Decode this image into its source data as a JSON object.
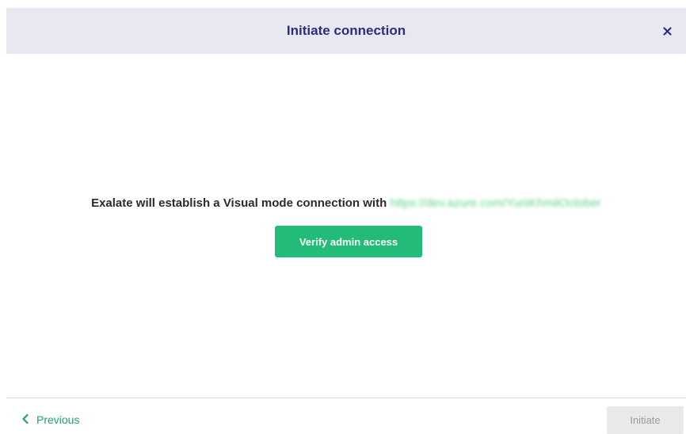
{
  "header": {
    "title": "Initiate connection",
    "close_icon": "close-icon"
  },
  "message": {
    "text": "Exalate will establish a Visual mode connection with ",
    "url": "https://dev.azure.com/YuriiKhmilOctober"
  },
  "verify": {
    "label": "Verify admin access"
  },
  "footer": {
    "previous_label": "Previous",
    "previous_icon": "chevron-left-icon",
    "initiate_label": "Initiate"
  },
  "colors": {
    "header_bg": "#e8e8f3",
    "title": "#2f2c7c",
    "accent": "#22bb78",
    "link": "#5fd38a",
    "disabled_bg": "#e9e9e9",
    "disabled_text": "#9a9a9a"
  }
}
